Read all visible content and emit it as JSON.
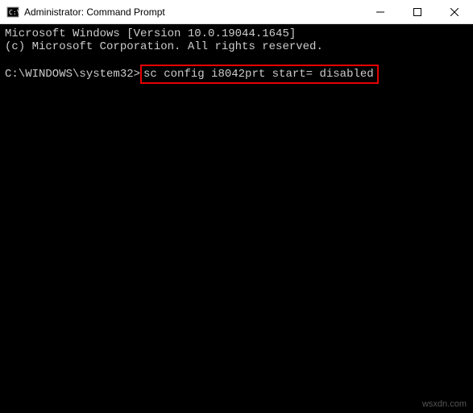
{
  "window": {
    "title": "Administrator: Command Prompt"
  },
  "terminal": {
    "line1": "Microsoft Windows [Version 10.0.19044.1645]",
    "line2": "(c) Microsoft Corporation. All rights reserved.",
    "prompt": "C:\\WINDOWS\\system32>",
    "command": "sc config i8042prt start= disabled"
  },
  "watermark": "wsxdn.com",
  "colors": {
    "highlight_border": "#e60000",
    "terminal_bg": "#000000",
    "terminal_fg": "#cccccc"
  }
}
